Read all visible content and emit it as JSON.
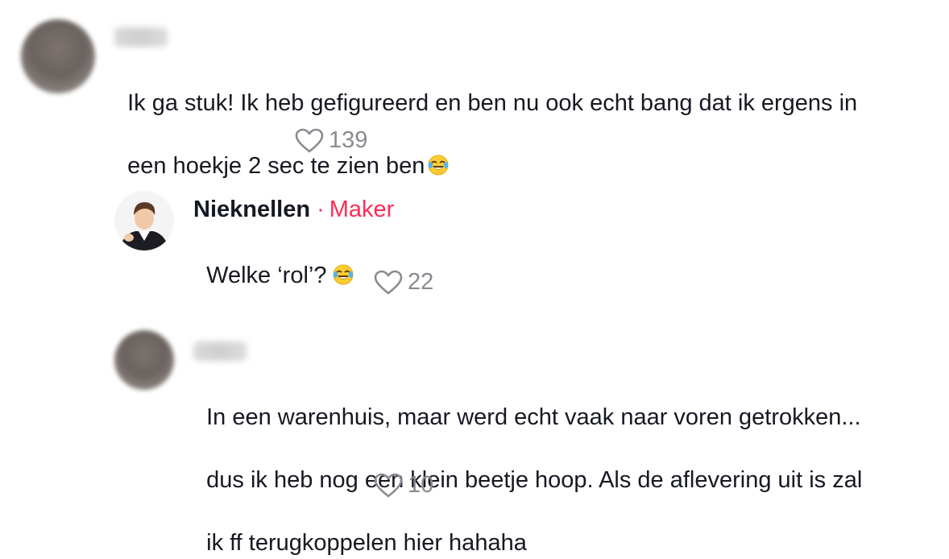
{
  "comments": [
    {
      "text_line1": "Ik ga stuk! Ik heb gefigureerd en ben nu ook echt bang dat ik ergens in",
      "text_line2": "een hoekje 2 sec te zien ben",
      "likes": "139"
    },
    {
      "author": "Nieknellen",
      "separator": "·",
      "badge": "Maker",
      "text_line1": "Welke ‘rol’?",
      "likes": "22"
    },
    {
      "text_line1": "In een warenhuis, maar werd echt vaak naar voren getrokken...",
      "text_line2": "dus ik heb nog een klein beetje hoop. Als de aflevering uit is zal",
      "text_line3": "ik ff terugkoppelen hier hahaha",
      "likes": "10"
    }
  ],
  "icons": {
    "like": "heart-outline-icon",
    "emoji": "face-with-tears-of-joy-icon"
  },
  "colors": {
    "text": "#161823",
    "muted": "#8a8b91",
    "maker_accent": "#fe2c55"
  }
}
